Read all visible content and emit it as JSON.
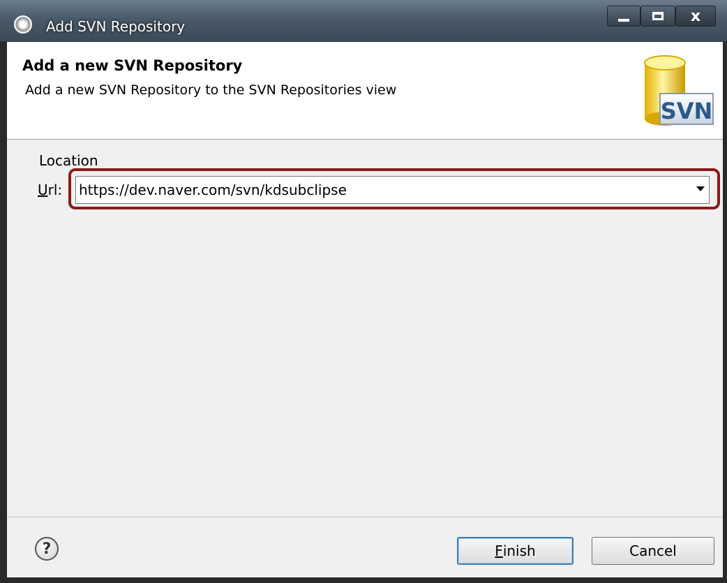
{
  "window": {
    "title": "Add SVN Repository",
    "controls": {
      "close_glyph": "x"
    }
  },
  "header": {
    "title": "Add a new SVN Repository",
    "description": "Add a new SVN Repository to the SVN Repositories view",
    "logo_text": "SVN"
  },
  "location": {
    "section_label": "Location",
    "url_label_mnemonic": "U",
    "url_label_rest": "rl:",
    "url_value": "https://dev.naver.com/svn/kdsubclipse"
  },
  "footer": {
    "help_glyph": "?",
    "finish_mnemonic": "F",
    "finish_rest": "inish",
    "cancel_label": "Cancel"
  },
  "colors": {
    "highlight_border": "#8b1a1a",
    "default_button_border": "#3c7fb1",
    "title_bar": "#4a5a69"
  },
  "icons": [
    "eclipse-gear-icon",
    "minimize-icon",
    "maximize-icon",
    "close-icon",
    "svn-database-icon",
    "help-icon",
    "chevron-down-icon"
  ]
}
